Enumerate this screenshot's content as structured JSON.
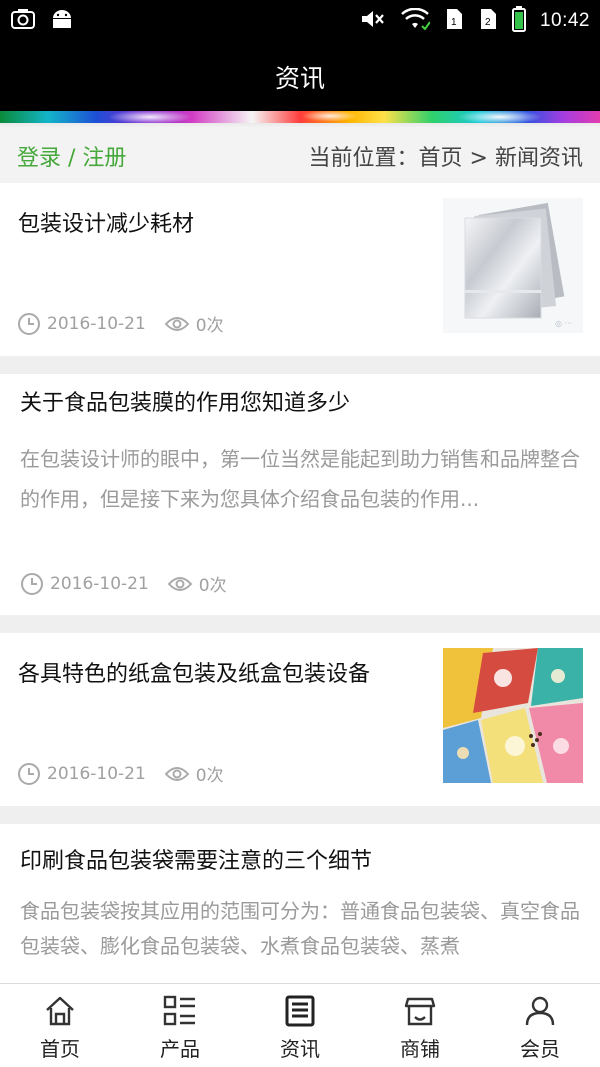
{
  "status_bar": {
    "time": "10:42"
  },
  "header": {
    "title": "资讯"
  },
  "breadcrumb": {
    "login": "登录",
    "separator": " / ",
    "register": "注册",
    "location_label": "当前位置：",
    "home": "首页",
    "arrow": " > ",
    "current": "新闻资讯"
  },
  "articles": [
    {
      "title": "包装设计减少耗材",
      "description": "",
      "date": "2016-10-21",
      "views": "0次",
      "thumbnail": "foil-bags"
    },
    {
      "title": "关于食品包装膜的作用您知道多少",
      "description": "在包装设计师的眼中，第一位当然是能起到助力销售和品牌整合的作用，但是接下来为您具体介绍食品包装的作用...",
      "date": "2016-10-21",
      "views": "0次",
      "thumbnail": ""
    },
    {
      "title": "各具特色的纸盒包装及纸盒包装设备",
      "description": "",
      "date": "2016-10-21",
      "views": "0次",
      "thumbnail": "colorful-boxes"
    },
    {
      "title": "印刷食品包装袋需要注意的三个细节",
      "description": "食品包装袋按其应用的范围可分为：普通食品包装袋、真空食品包装袋、膨化食品包装袋、水煮食品包装袋、蒸煮",
      "date": "",
      "views": "",
      "thumbnail": ""
    }
  ],
  "bottom_nav": [
    {
      "label": "首页",
      "icon": "home-icon"
    },
    {
      "label": "产品",
      "icon": "grid-list-icon"
    },
    {
      "label": "资讯",
      "icon": "news-icon",
      "active": true
    },
    {
      "label": "商铺",
      "icon": "shop-icon"
    },
    {
      "label": "会员",
      "icon": "user-icon"
    }
  ]
}
